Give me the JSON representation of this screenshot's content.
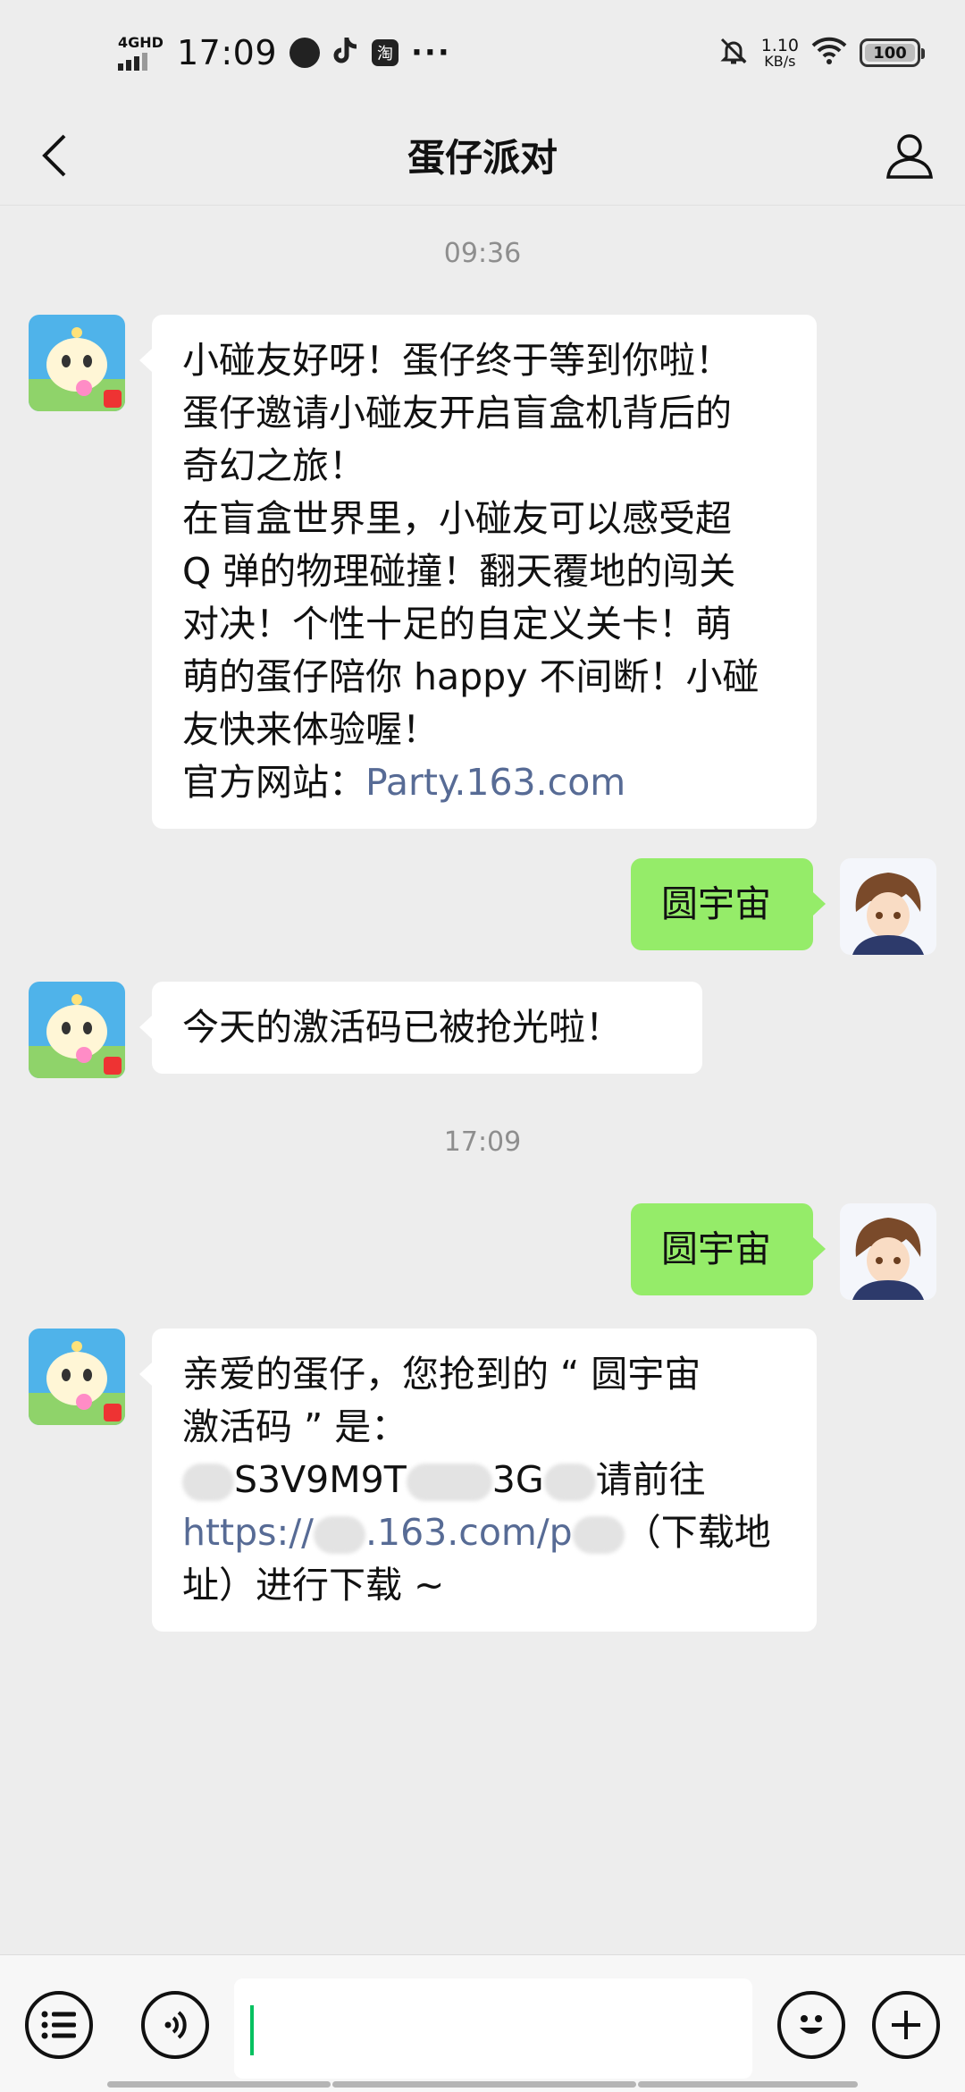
{
  "status_bar": {
    "network": "4GHD",
    "time": "17:09",
    "tb_icon_text": "淘",
    "more": "···",
    "speed_value": "1.10",
    "speed_unit": "KB/s",
    "battery": "100",
    "icons": [
      "whatsapp-style-circle-icon",
      "tiktok-icon",
      "taobao-icon",
      "mute-bell-icon",
      "wifi-icon",
      "battery-icon"
    ]
  },
  "header": {
    "title": "蛋仔派对",
    "back_icon": "chevron-left-icon",
    "profile_icon": "person-icon"
  },
  "messages": [
    {
      "type": "timestamp",
      "text": "09:36"
    },
    {
      "type": "incoming",
      "lines": [
        "小碰友好呀！蛋仔终于等到你啦！",
        "蛋仔邀请小碰友开启盲盒机背后的",
        "奇幻之旅！",
        "在盲盒世界里，小碰友可以感受超",
        "Q 弹的物理碰撞！翻天覆地的闯关",
        "对决！个性十足的自定义关卡！萌",
        "萌的蛋仔陪你 happy 不间断！小碰",
        "友快来体验喔！"
      ],
      "site_label": "官方网站：",
      "site_link": "Party.163.com"
    },
    {
      "type": "outgoing",
      "text": "圆宇宙"
    },
    {
      "type": "incoming",
      "text": "今天的激活码已被抢光啦！"
    },
    {
      "type": "timestamp",
      "text": "17:09"
    },
    {
      "type": "outgoing",
      "text": "圆宇宙"
    },
    {
      "type": "incoming",
      "line1": "亲爱的蛋仔，您抢到的 “ 圆宇宙",
      "line2": "激活码 ” 是：",
      "code_a": "S3V9M9T",
      "code_b": "3G",
      "code_suffix": "请前往",
      "link_a": "https://",
      "link_b": ".163.com/p",
      "link_suffix": "（下载地",
      "line5": "址）进行下载 ~"
    }
  ],
  "input_bar": {
    "menu_icon": "list-menu-icon",
    "voice_icon": "voice-icon",
    "emoji_icon": "emoji-icon",
    "add_icon": "plus-icon",
    "input_value": ""
  },
  "colors": {
    "background": "#ededed",
    "incoming_bubble": "#ffffff",
    "outgoing_bubble": "#95ec69",
    "link": "#576b95",
    "caret": "#07c160"
  }
}
